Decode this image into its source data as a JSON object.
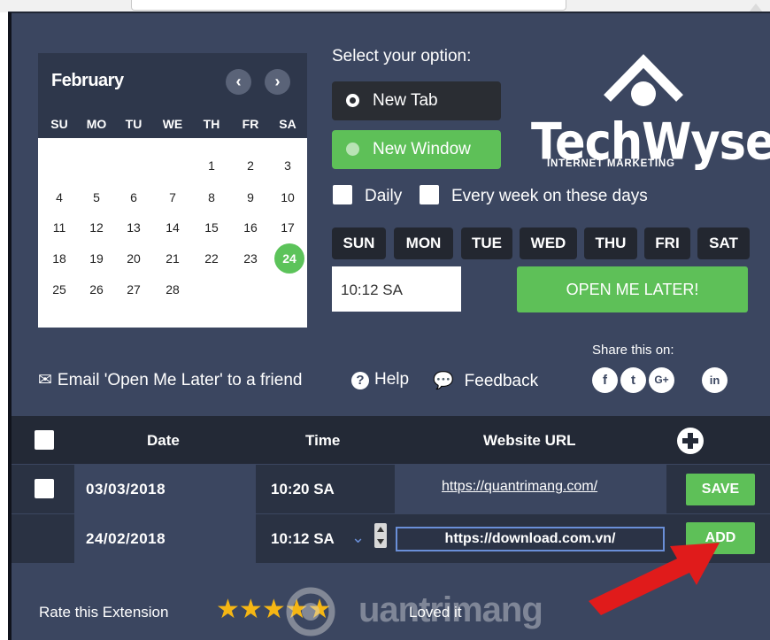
{
  "calendar": {
    "month": "February",
    "prev_icon": "chevron-left-icon",
    "next_icon": "chevron-right-icon",
    "weekdays": [
      "SU",
      "MO",
      "TU",
      "WE",
      "TH",
      "FR",
      "SA"
    ],
    "weeks": [
      [
        "",
        "",
        "",
        "",
        "1",
        "2",
        "3"
      ],
      [
        "4",
        "5",
        "6",
        "7",
        "8",
        "9",
        "10"
      ],
      [
        "11",
        "12",
        "13",
        "14",
        "15",
        "16",
        "17"
      ],
      [
        "18",
        "19",
        "20",
        "21",
        "22",
        "23",
        "24"
      ],
      [
        "25",
        "26",
        "27",
        "28",
        "",
        "",
        ""
      ]
    ],
    "selected_day": "24"
  },
  "options": {
    "title": "Select your option:",
    "new_tab": "New Tab",
    "new_window": "New Window"
  },
  "logo": {
    "word": "TechWyse",
    "sub": "INTERNET MARKETING"
  },
  "repeat": {
    "daily": "Daily",
    "weekly": "Every week on these days"
  },
  "days": [
    "SUN",
    "MON",
    "TUE",
    "WED",
    "THU",
    "FRI",
    "SAT"
  ],
  "time_value": "10:12 SA",
  "open_button": "OPEN ME LATER!",
  "links": {
    "email": "Email 'Open Me Later' to a friend",
    "help": "Help",
    "feedback": "Feedback"
  },
  "share": {
    "label": "Share this on:",
    "icons": [
      "f",
      "t",
      "G+",
      "in"
    ]
  },
  "table": {
    "headers": {
      "date": "Date",
      "time": "Time",
      "url": "Website URL"
    },
    "rows": [
      {
        "date": "03/03/2018",
        "time": "10:20 SA",
        "url": "https://quantrimang.com/",
        "action": "SAVE"
      },
      {
        "date": "24/02/2018",
        "time": "10:12 SA",
        "url": "https://download.com.vn/",
        "action": "ADD"
      }
    ]
  },
  "rating": {
    "label": "Rate this Extension",
    "stars": 5,
    "caption": "Loved it"
  },
  "watermark": "uantrimang",
  "colors": {
    "panel": "#3b4660",
    "green": "#5ec058",
    "dark": "#232936",
    "star": "#f5b614",
    "arrow": "#e01b1b"
  }
}
